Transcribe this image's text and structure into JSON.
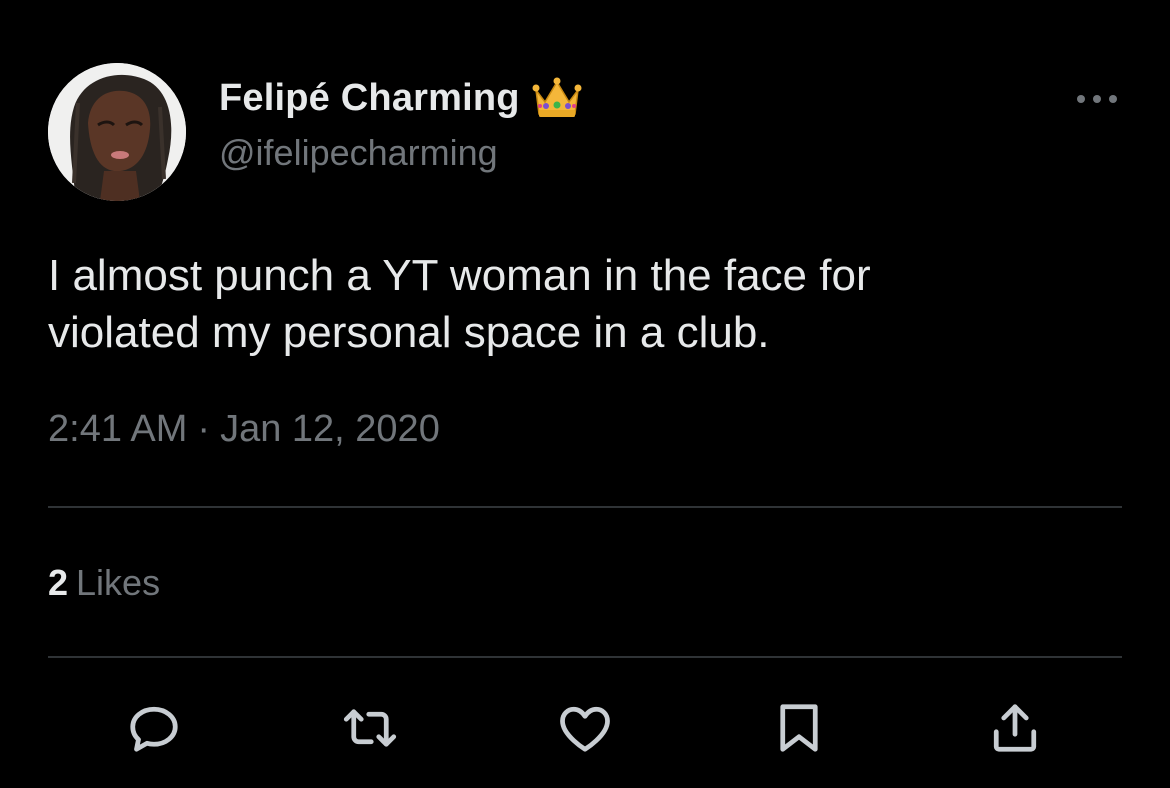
{
  "author": {
    "display_name": "Felipé Charming",
    "handle": "@ifelipecharming",
    "badge_icon": "crown-icon",
    "avatar_icon": "profile-photo"
  },
  "tweet": {
    "text": "I almost punch a YT woman in the face for\nviolated my personal space in a club.",
    "time": "2:41 AM",
    "separator": "·",
    "date": "Jan 12, 2020"
  },
  "stats": {
    "likes_count": "2",
    "likes_label": "Likes"
  },
  "actions": [
    {
      "name": "reply",
      "icon": "reply-icon"
    },
    {
      "name": "retweet",
      "icon": "retweet-icon"
    },
    {
      "name": "like",
      "icon": "heart-icon"
    },
    {
      "name": "bookmark",
      "icon": "bookmark-icon"
    },
    {
      "name": "share",
      "icon": "share-icon"
    }
  ],
  "colors": {
    "background": "#000000",
    "primary_text": "#e7e9ea",
    "secondary_text": "#71767b",
    "divider": "#2f3336",
    "icon": "#c8cdd2"
  }
}
